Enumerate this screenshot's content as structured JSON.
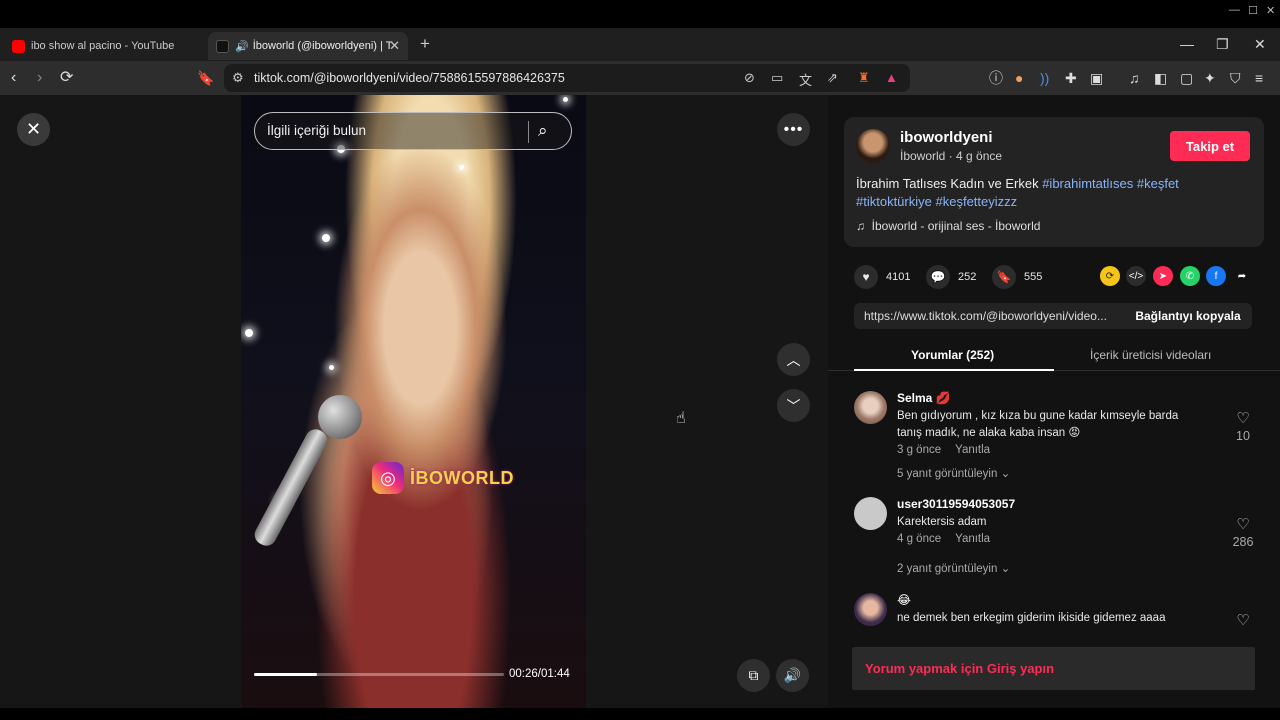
{
  "browser": {
    "tabs": [
      {
        "title": "ibo show al pacino - YouTube"
      },
      {
        "title": "İboworld (@iboworldyeni) | T",
        "close": "✕"
      }
    ],
    "new_tab": "+",
    "url": "tiktok.com/@iboworldyeni/video/7588615597886426375"
  },
  "video": {
    "search_placeholder": "İlgili içeriği bulun",
    "time": "00:26/01:44",
    "progress": 0.25,
    "watermark": "İBOWORLD"
  },
  "post": {
    "username": "iboworldyeni",
    "subtitle": "İboworld · 4 g önce",
    "follow_label": "Takip et",
    "desc_text": "İbrahim Tatlıses Kadın ve Erkek",
    "hashtags": [
      "#ibrahimtatlıses",
      "#keşfet",
      "#tiktoktürkiye",
      "#keşfetteyizzz"
    ],
    "music": "İboworld - orijinal ses - İboworld",
    "likes": "4101",
    "comments": "252",
    "saves": "555",
    "link": "https://www.tiktok.com/@iboworldyeni/video...",
    "copy_label": "Bağlantıyı kopyala"
  },
  "panel_tabs": {
    "comments_tab": "Yorumlar (252)",
    "creator_tab": "İçerik üreticisi videoları"
  },
  "comments": [
    {
      "name": "Selma 💋",
      "text": "Ben gıdıyorum , kız kıza bu gune kadar kımseyle barda tanış madık, ne alaka kaba insan 😡",
      "time": "3 g önce",
      "reply": "Yanıtla",
      "likes": "10",
      "more": "5 yanıt görüntüleyin ⌄"
    },
    {
      "name": "user30119594053057",
      "text": "Karektersis adam",
      "time": "4 g önce",
      "reply": "Yanıtla",
      "likes": "286",
      "more": "2 yanıt görüntüleyin ⌄"
    },
    {
      "name": "😂",
      "text": "ne demek ben erkegim giderim ikiside gidemez aaaa",
      "time": "",
      "reply": "",
      "likes": "",
      "more": ""
    }
  ],
  "login_prompt": "Yorum yapmak için Giriş yapın",
  "colors": {
    "accent": "#fe2c55",
    "hashtag": "#8ab4f8"
  }
}
